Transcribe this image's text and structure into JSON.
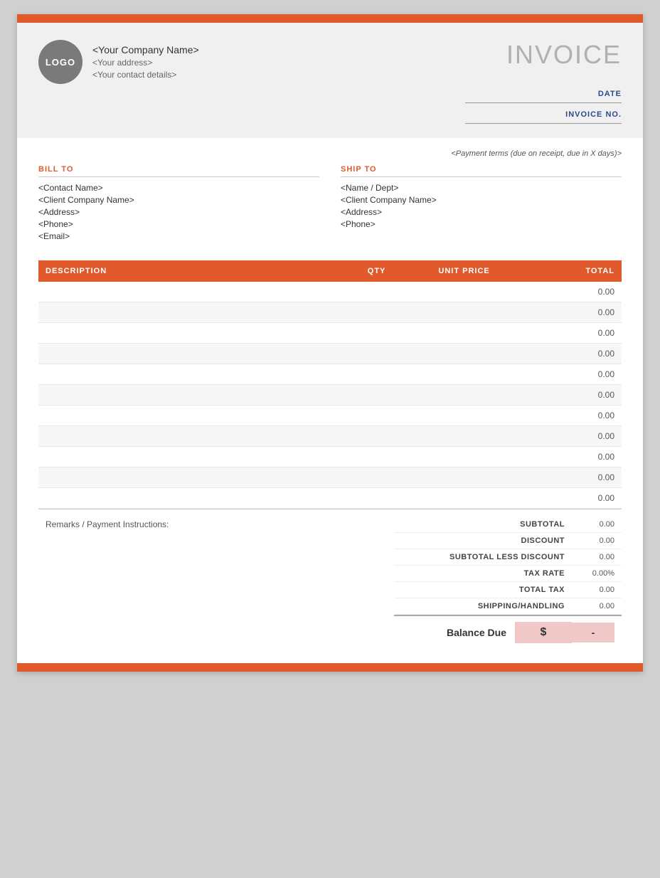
{
  "topBar": {
    "color": "#e05a2b"
  },
  "header": {
    "logo_text": "LOGO",
    "company_name": "<Your Company Name>",
    "company_address": "<Your address>",
    "company_contact": "<Your contact details>",
    "invoice_title": "INVOICE",
    "date_label": "DATE",
    "invoice_no_label": "INVOICE NO."
  },
  "payment_terms": "<Payment terms (due on receipt, due in X days)>",
  "bill_to": {
    "section_label": "BILL TO",
    "contact_name": "<Contact Name>",
    "company_name": "<Client Company Name>",
    "address": "<Address>",
    "phone": "<Phone>",
    "email": "<Email>"
  },
  "ship_to": {
    "section_label": "SHIP TO",
    "name_dept": "<Name / Dept>",
    "company_name": "<Client Company Name>",
    "address": "<Address>",
    "phone": "<Phone>"
  },
  "table": {
    "headers": {
      "description": "DESCRIPTION",
      "qty": "QTY",
      "unit_price": "UNIT PRICE",
      "total": "TOTAL"
    },
    "rows": [
      {
        "description": "",
        "qty": "",
        "unit_price": "",
        "total": "0.00"
      },
      {
        "description": "",
        "qty": "",
        "unit_price": "",
        "total": "0.00"
      },
      {
        "description": "",
        "qty": "",
        "unit_price": "",
        "total": "0.00"
      },
      {
        "description": "",
        "qty": "",
        "unit_price": "",
        "total": "0.00"
      },
      {
        "description": "",
        "qty": "",
        "unit_price": "",
        "total": "0.00"
      },
      {
        "description": "",
        "qty": "",
        "unit_price": "",
        "total": "0.00"
      },
      {
        "description": "",
        "qty": "",
        "unit_price": "",
        "total": "0.00"
      },
      {
        "description": "",
        "qty": "",
        "unit_price": "",
        "total": "0.00"
      },
      {
        "description": "",
        "qty": "",
        "unit_price": "",
        "total": "0.00"
      },
      {
        "description": "",
        "qty": "",
        "unit_price": "",
        "total": "0.00"
      },
      {
        "description": "",
        "qty": "",
        "unit_price": "",
        "total": "0.00"
      }
    ]
  },
  "summary": {
    "remarks_label": "Remarks / Payment Instructions:",
    "subtotal_label": "SUBTOTAL",
    "subtotal_value": "0.00",
    "discount_label": "DISCOUNT",
    "discount_value": "0.00",
    "subtotal_less_discount_label": "SUBTOTAL LESS DISCOUNT",
    "subtotal_less_discount_value": "0.00",
    "tax_rate_label": "TAX RATE",
    "tax_rate_value": "0.00%",
    "total_tax_label": "TOTAL TAX",
    "total_tax_value": "0.00",
    "shipping_label": "SHIPPING/HANDLING",
    "shipping_value": "0.00",
    "balance_due_label": "Balance Due",
    "balance_due_currency": "$",
    "balance_due_value": "-"
  }
}
